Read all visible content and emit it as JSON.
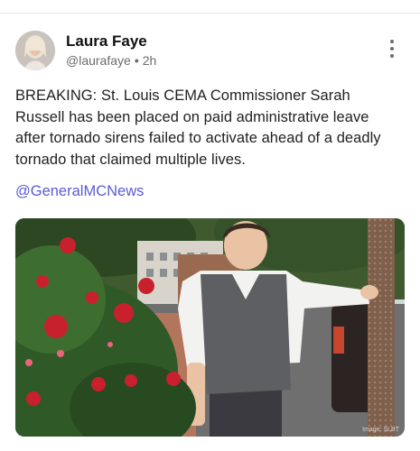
{
  "post": {
    "author_name": "Laura Faye",
    "handle": "@laurafaye",
    "separator": "•",
    "time_ago": "2h",
    "text": "BREAKING: St. Louis CEMA Commissioner Sarah Russell has been placed on paid administrative leave after tornado sirens failed to activate ahead of a deadly tornado that claimed multiple lives.",
    "mention": "@GeneralMCNews",
    "image_credit": "Image: SLBT"
  },
  "icons": {
    "more": "more-vertical-icon",
    "avatar": "avatar-photo"
  }
}
